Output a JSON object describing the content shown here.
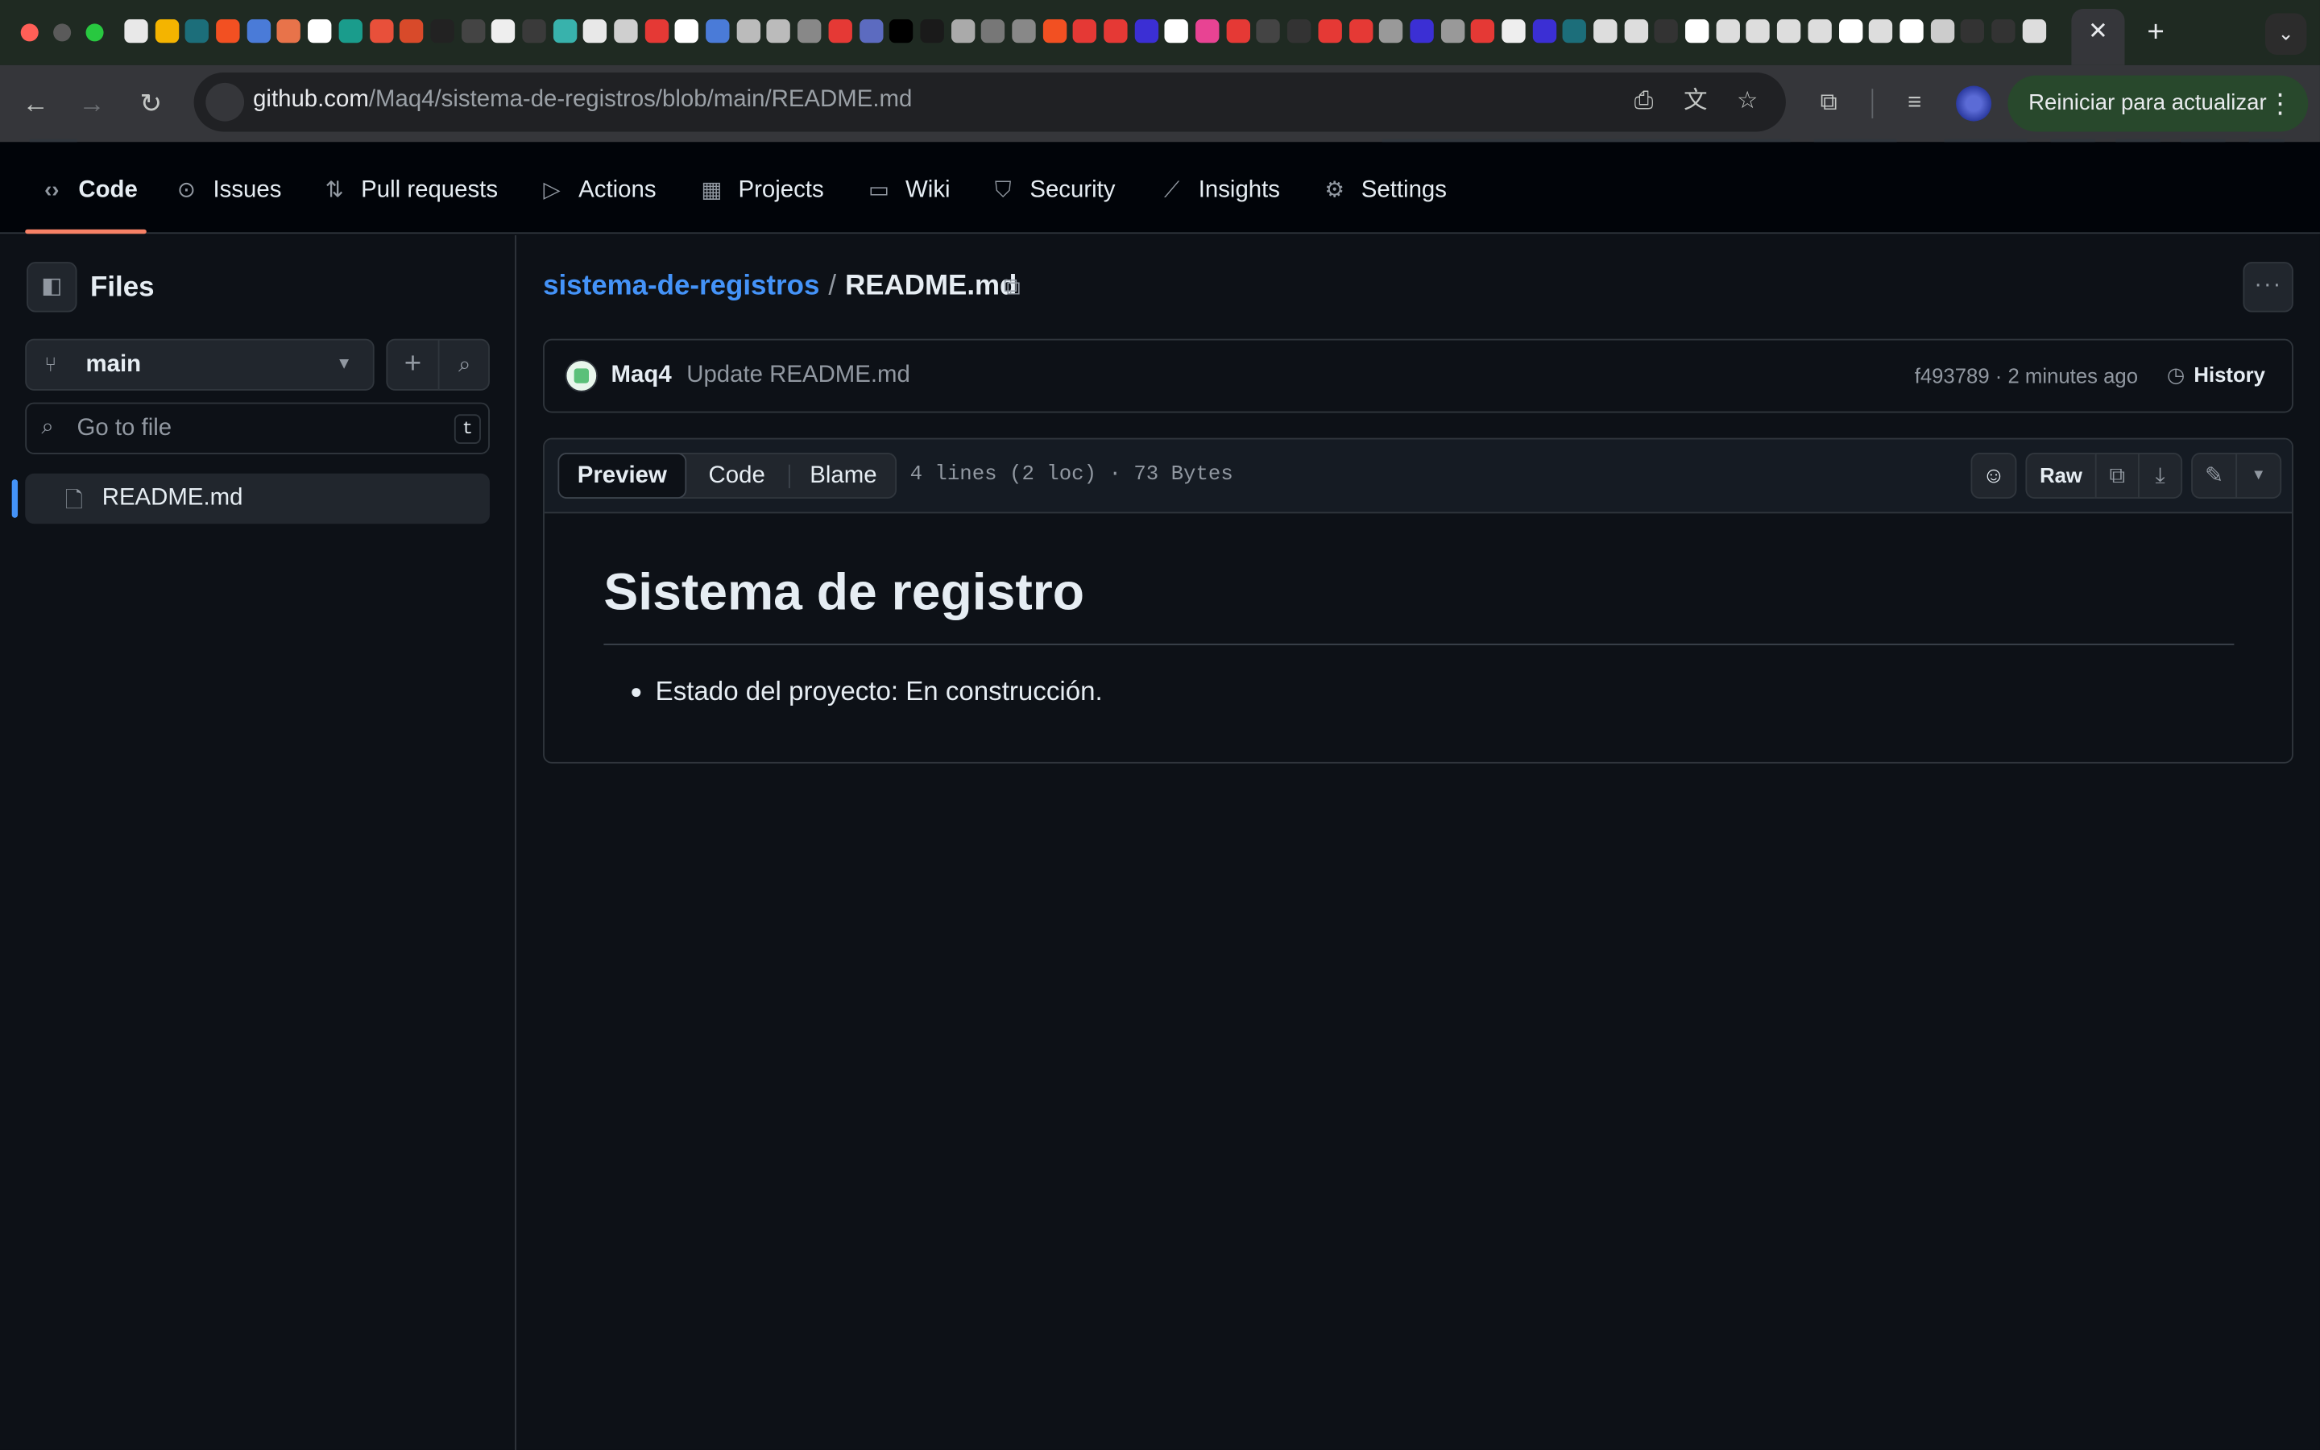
{
  "browser": {
    "url_host": "github.com",
    "url_path": "/Maq4/sistema-de-registros/blob/main/README.md",
    "update_button": "Reiniciar para actualizar",
    "tab_close": "✕",
    "new_tab": "+",
    "favicon_colors": [
      "#e8e8e8",
      "#f4b400",
      "#1c6e7a",
      "#f25022",
      "#4a7bd8",
      "#e8734a",
      "#ffffff",
      "#1a9c8c",
      "#e8503a",
      "#d84a2a",
      "#222222",
      "#444444",
      "#eeeeee",
      "#3a3a3a",
      "#38b2ac",
      "#e8e8e8",
      "#cfcfcf",
      "#e53935",
      "#ffffff",
      "#4a7bd8",
      "#bbbbbb",
      "#bbbbbb",
      "#888888",
      "#e53935",
      "#5c6bc0",
      "#000000",
      "#1a1a1a",
      "#aaaaaa",
      "#777777",
      "#888888",
      "#f25022",
      "#e53935",
      "#e53935",
      "#3b2fd4",
      "#ffffff",
      "#e84393",
      "#e53935",
      "#444444",
      "#333333",
      "#e53935",
      "#e53935",
      "#999999",
      "#3b2fd4",
      "#999999",
      "#e53935",
      "#eeeeee",
      "#3b2fd4",
      "#1c6e7a",
      "#dddddd",
      "#dddddd",
      "#333333",
      "#ffffff",
      "#dddddd",
      "#dddddd",
      "#dddddd",
      "#dddddd",
      "#ffffff",
      "#dddddd",
      "#ffffff",
      "#cccccc",
      "#333333",
      "#333333",
      "#dddddd"
    ]
  },
  "repo_nav": {
    "tabs": [
      {
        "label": "Code",
        "icon": "code-icon",
        "glyph": "‹›",
        "selected": true
      },
      {
        "label": "Issues",
        "icon": "issue-icon",
        "glyph": "⊙"
      },
      {
        "label": "Pull requests",
        "icon": "pull-request-icon",
        "glyph": "⇅"
      },
      {
        "label": "Actions",
        "icon": "play-icon",
        "glyph": "▷"
      },
      {
        "label": "Projects",
        "icon": "table-icon",
        "glyph": "▦"
      },
      {
        "label": "Wiki",
        "icon": "book-icon",
        "glyph": "▭"
      },
      {
        "label": "Security",
        "icon": "shield-icon",
        "glyph": "⛉"
      },
      {
        "label": "Insights",
        "icon": "graph-icon",
        "glyph": "⟋"
      },
      {
        "label": "Settings",
        "icon": "gear-icon",
        "glyph": "⚙"
      }
    ]
  },
  "sidebar": {
    "title": "Files",
    "branch": "main",
    "goto_placeholder": "Go to file",
    "goto_shortcut": "t",
    "tree": [
      {
        "label": "README.md",
        "icon": "file-icon",
        "selected": true
      }
    ]
  },
  "main": {
    "breadcrumb_repo": "sistema-de-registros",
    "breadcrumb_sep": "/",
    "breadcrumb_file": "README.md",
    "commit": {
      "author": "Maq4",
      "message": "Update README.md",
      "meta": "f493789 · 2 minutes ago",
      "history_label": "History"
    },
    "file": {
      "views": [
        "Preview",
        "Code",
        "Blame"
      ],
      "active_view": "Preview",
      "stats": "4 lines (2 loc) · 73 Bytes",
      "raw_label": "Raw"
    },
    "readme": {
      "heading": "Sistema de registro",
      "items": [
        "Estado del proyecto: En construcción."
      ]
    }
  },
  "colors": {
    "accent_link": "#4493f8",
    "tab_underline": "#f78166",
    "background": "#0d1117"
  }
}
